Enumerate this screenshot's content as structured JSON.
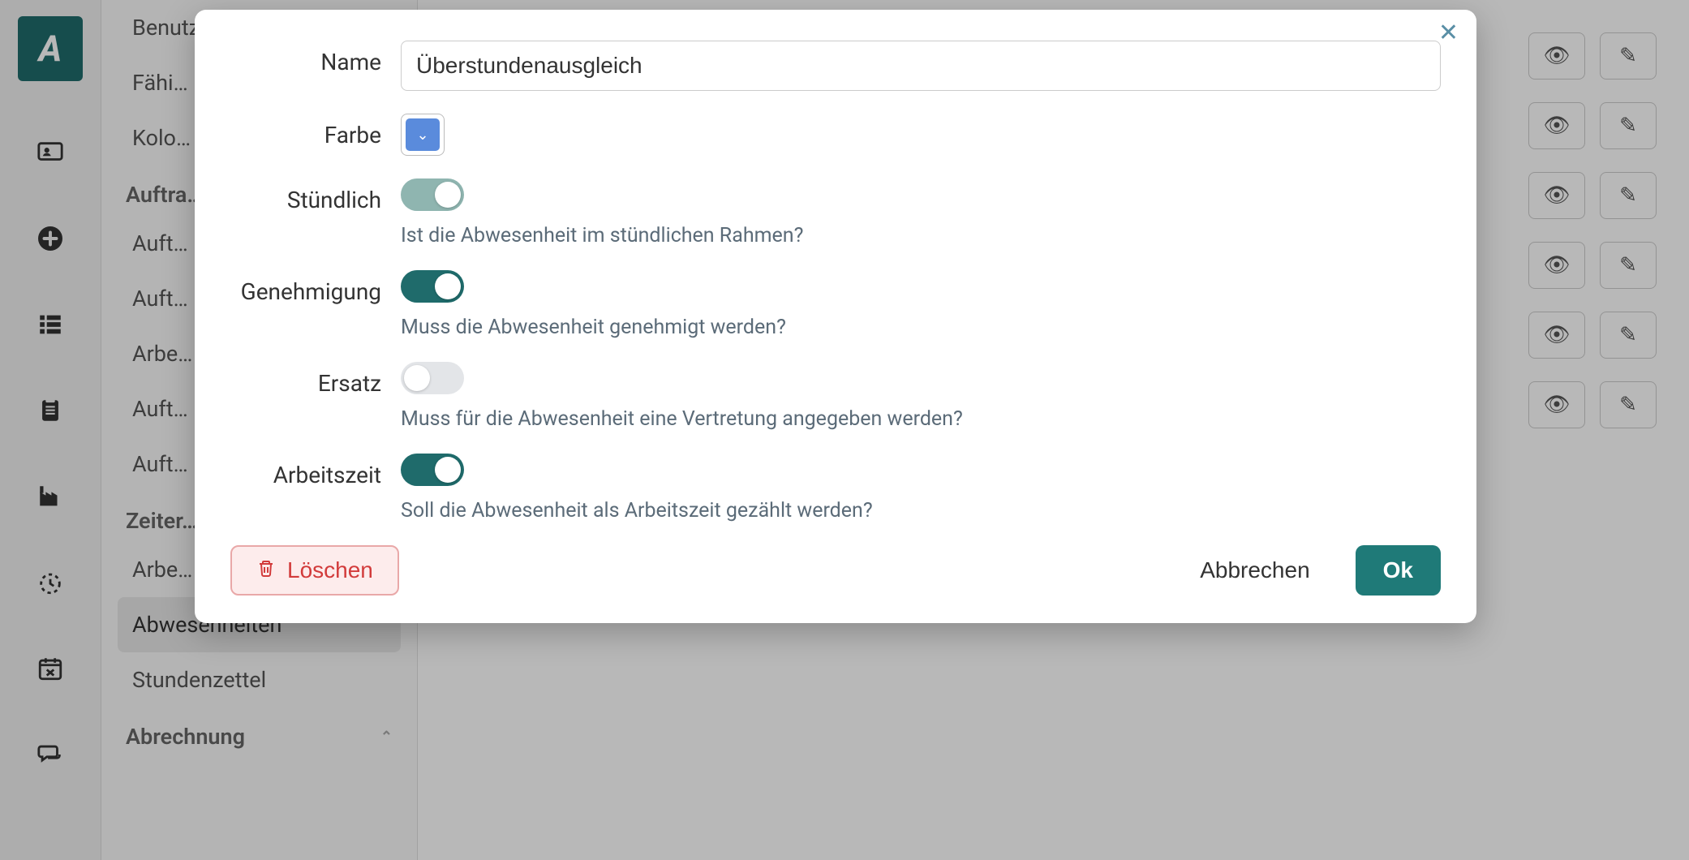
{
  "sidebar": {
    "items": [
      {
        "label": "Benutzerrollen",
        "active": false
      },
      {
        "label": "Fähi…",
        "active": false
      },
      {
        "label": "Kolo…",
        "active": false
      }
    ],
    "sections": [
      {
        "heading": "Auftra…",
        "items": [
          {
            "label": "Auft…"
          },
          {
            "label": "Auft…"
          },
          {
            "label": "Arbe…"
          },
          {
            "label": "Auft…"
          },
          {
            "label": "Auft…"
          }
        ]
      },
      {
        "heading": "Zeiter…",
        "items": [
          {
            "label": "Arbe…"
          },
          {
            "label": "Abwesenheiten",
            "active": true
          },
          {
            "label": "Stundenzettel"
          }
        ]
      },
      {
        "heading": "Abrechnung",
        "items": []
      }
    ]
  },
  "modal": {
    "fields": {
      "name": {
        "label": "Name",
        "value": "Überstundenausgleich"
      },
      "color": {
        "label": "Farbe",
        "swatch": "#5a8bdc"
      },
      "hourly": {
        "label": "Stündlich",
        "value": true,
        "muted": true,
        "help": "Ist die Abwesenheit im stündlichen Rahmen?"
      },
      "approval": {
        "label": "Genehmigung",
        "value": true,
        "help": "Muss die Abwesenheit genehmigt werden?"
      },
      "substitute": {
        "label": "Ersatz",
        "value": false,
        "help": "Muss für die Abwesenheit eine Vertretung angegeben werden?"
      },
      "worktime": {
        "label": "Arbeitszeit",
        "value": true,
        "help": "Soll die Abwesenheit als Arbeitszeit gezählt werden?"
      }
    },
    "buttons": {
      "delete": "Löschen",
      "cancel": "Abbrechen",
      "ok": "Ok"
    }
  }
}
